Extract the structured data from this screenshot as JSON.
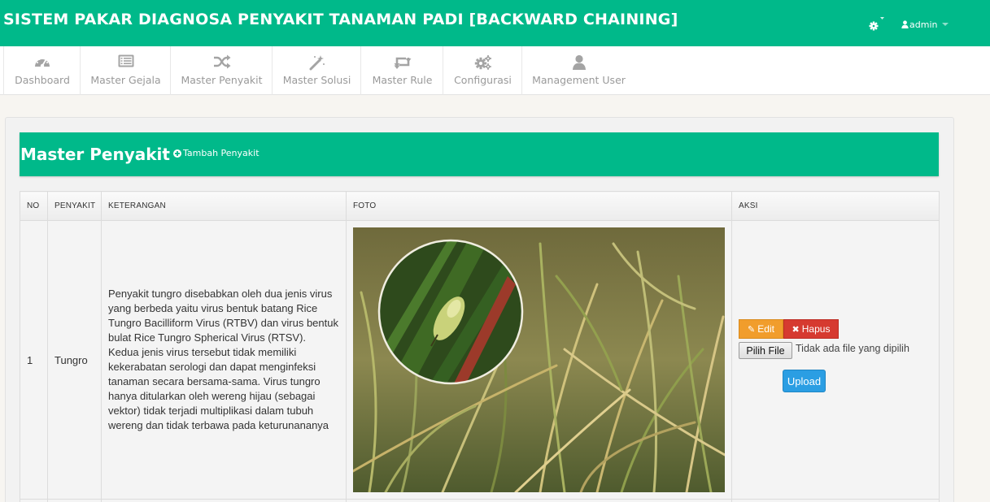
{
  "header": {
    "title": "SISTEM PAKAR DIAGNOSA PENYAKIT TANAMAN PADI [BACKWARD CHAINING]",
    "user": "admin"
  },
  "shortcuts": [
    {
      "label": "Dashboard",
      "icon": "dashboard-icon"
    },
    {
      "label": "Master Gejala",
      "icon": "list-alt-icon"
    },
    {
      "label": "Master Penyakit",
      "icon": "random-icon"
    },
    {
      "label": "Master Solusi",
      "icon": "magic-wand-icon"
    },
    {
      "label": "Master Rule",
      "icon": "retweet-icon"
    },
    {
      "label": "Configurasi",
      "icon": "cogs-icon"
    },
    {
      "label": "Management User",
      "icon": "user-icon"
    }
  ],
  "page": {
    "title": "Master Penyakit",
    "add_label": "Tambah Penyakit"
  },
  "table": {
    "columns": [
      "NO",
      "PENYAKIT",
      "KETERANGAN",
      "FOTO",
      "AKSI"
    ],
    "rows": [
      {
        "no": "1",
        "penyakit": "Tungro",
        "keterangan": "Penyakit tungro disebabkan oleh dua jenis virus yang berbeda yaitu virus bentuk batang Rice Tungro Bacilliform Virus (RTBV) dan virus bentuk bulat Rice Tungro Spherical Virus (RTSV). Kedua jenis virus tersebut tidak memiliki kekerabatan serologi dan dapat menginfeksi tanaman secara bersama-sama. Virus tungro hanya ditularkan oleh wereng hijau (sebagai vektor) tidak terjadi multiplikasi dalam tubuh wereng dan tidak terbawa pada keturunananya",
        "aksi": {
          "edit_label": "Edit",
          "hapus_label": "Hapus",
          "file_button": "Pilih File",
          "file_status": "Tidak ada file yang dipilih",
          "upload_label": "Upload"
        }
      }
    ]
  },
  "colors": {
    "brand": "#00b98a",
    "edit": "#f19d2c",
    "hapus": "#d63a30",
    "upload": "#2b9ee3"
  }
}
